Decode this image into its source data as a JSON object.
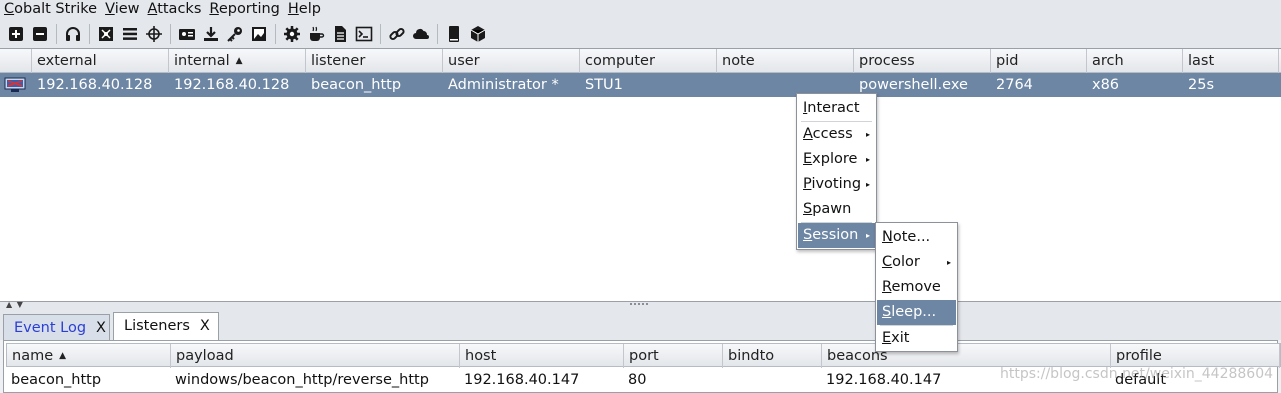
{
  "menubar": {
    "items": [
      {
        "mnemonic": "C",
        "rest": "obalt Strike"
      },
      {
        "mnemonic": "V",
        "rest": "iew"
      },
      {
        "mnemonic": "A",
        "rest": "ttacks"
      },
      {
        "mnemonic": "R",
        "rest": "eporting"
      },
      {
        "mnemonic": "H",
        "rest": "elp"
      }
    ]
  },
  "toolbar": {
    "icons": [
      "new-connection-icon",
      "disconnect-icon",
      "listeners-headset-icon",
      "pivot-graph-icon",
      "session-table-icon",
      "targets-crosshair-icon",
      "credentials-icon",
      "downloads-icon",
      "keystrokes-key-icon",
      "screenshots-icon",
      "settings-gear-icon",
      "java-applet-cup-icon",
      "office-macro-doc-icon",
      "script-console-icon",
      "link-icon",
      "cloud-host-icon",
      "help-book-icon",
      "about-package-icon"
    ]
  },
  "beacons": {
    "columns": [
      "",
      "external",
      "internal",
      "listener",
      "user",
      "computer",
      "note",
      "process",
      "pid",
      "arch",
      "last"
    ],
    "sorted_column": "internal",
    "rows": [
      {
        "external": "192.168.40.128",
        "internal": "192.168.40.128",
        "listener": "beacon_http",
        "user": "Administrator *",
        "computer": "STU1",
        "note": "",
        "process": "powershell.exe",
        "pid": "2764",
        "arch": "x86",
        "last": "25s"
      }
    ]
  },
  "context_menu": {
    "items": [
      {
        "mnemonic": "I",
        "rest": "nteract",
        "submenu": false
      },
      {
        "mnemonic": "A",
        "rest": "ccess",
        "submenu": true
      },
      {
        "mnemonic": "E",
        "rest": "xplore",
        "submenu": true
      },
      {
        "mnemonic": "P",
        "rest": "ivoting",
        "submenu": true
      },
      {
        "mnemonic": "S",
        "rest": "pawn",
        "submenu": false
      },
      {
        "mnemonic": "S",
        "rest": "ession",
        "submenu": true,
        "highlighted": true
      }
    ]
  },
  "session_menu": {
    "items": [
      {
        "mnemonic": "N",
        "rest": "ote...",
        "submenu": false
      },
      {
        "mnemonic": "C",
        "rest": "olor",
        "submenu": true
      },
      {
        "mnemonic": "R",
        "rest": "emove",
        "submenu": false
      },
      {
        "mnemonic": "S",
        "rest": "leep...",
        "submenu": false,
        "highlighted": true
      },
      {
        "mnemonic": "E",
        "rest": "xit",
        "submenu": false
      }
    ]
  },
  "tabs": [
    {
      "label": "Event Log",
      "close": "X"
    },
    {
      "label": "Listeners",
      "close": "X",
      "active": true
    }
  ],
  "listeners": {
    "columns": [
      "name",
      "payload",
      "host",
      "port",
      "bindto",
      "beacons",
      "profile"
    ],
    "sorted_column": "name",
    "rows": [
      {
        "name": "beacon_http",
        "payload": "windows/beacon_http/reverse_http",
        "host": "192.168.40.147",
        "port": "80",
        "bindto": "",
        "beacons": "192.168.40.147",
        "profile": "default"
      }
    ]
  },
  "watermark": "https://blog.csdn.net/weixin_44288604",
  "colors": {
    "selection": "#6d86a4",
    "background": "#eef0f3",
    "event_log_tab_text": "#2a3fd6"
  }
}
